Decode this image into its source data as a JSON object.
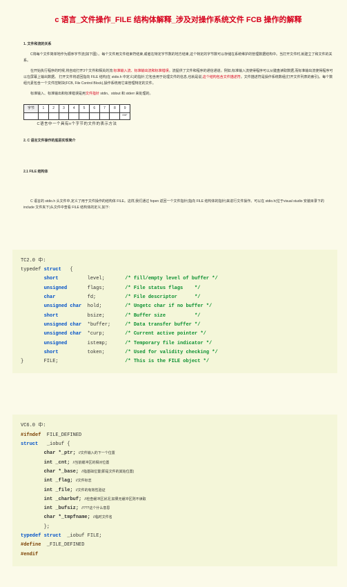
{
  "title": "c 语言_文件操作_FILE 结构体解释_涉及对操作系统文件 FCB 操作的解释",
  "s1": {
    "head": "1. 文件和流的关系",
    "p1a": "C将每个文件简单地作为顺序字节流(如下图) 。每个文件用文件结束符结束,或者在特定字节数的地方结束,这个特定的字节数可以存储在系统维护的管理数据结构中。当打开文件时,就建立了和文件的关系。",
    "p1b_1": "在开始执行程序的时候,将自动打开3个文件和相关的流:",
    "p1b_red": "标准输入流、标准输出流和标准错误",
    "p1b_2": "。流提供了文件和程序的通信通道。例如,标准输入流使得程序可以从键盘读取数据,而标准输出流使得程序可以在屏幕上输出数据。",
    "p1c_1": "打开文件将返回指向 FILE 结构(在 stdio.h 中定义)的指针,它包含用于处理文件的信息,也就是说,",
    "p1c_red": "这个结构包含文件描述符",
    "p1c_2": "。文件描述符是操作系统数组(打开文件列表的索引)。每个数组元素包含一个文件控制块(FCB, File Control Block),操作系统用它来管理特定的文件。",
    "p1d_1": "标准输入、标准输出和标准错误是用",
    "p1d_red": "文件指针",
    "p1d_2": " stdin、stdout 和 stderr 来处理的。",
    "fig_bytes_label": "字节",
    "fig_nums": [
      "1",
      "2",
      "3",
      "4",
      "5",
      "6",
      "7",
      "8",
      "9"
    ],
    "fig_row2": [
      "",
      "",
      "",
      "",
      "",
      "",
      "",
      "",
      "EOF"
    ],
    "fig_cap": "C语言中一个具有n个字节的文件的表示方法"
  },
  "s2": {
    "head": "2. C 语言文件操作的底层实现简介",
    "sub": "2.1  FILE 结构体",
    "p1": "C 语言的 stdio.h 头文件中,定义了用于文件操作的结构体 FILE。这样,我们通过 fopen 返回一个文件指针(指向 FILE 结构体的指针)来进行文件操作。可以在 stdio.h(位于visual studio 安装目录下的 include 文件夹下)头文件中查看 FILE 结构体的定义,如下:"
  },
  "tc": {
    "label": "TC2.0 中:",
    "lines": [
      {
        "pre": "typedef ",
        "kw": "struct",
        "post": "   {",
        "cm": ""
      },
      {
        "pre": "        ",
        "kw": "short",
        "post": "          level;",
        "cm": "/* fill/empty level of buffer */"
      },
      {
        "pre": "        ",
        "kw": "unsigned",
        "post": "       flags;",
        "cm": "/* File status flags    */"
      },
      {
        "pre": "        ",
        "kw": "char",
        "post": "           fd;",
        "cm": "/* File descriptor      */"
      },
      {
        "pre": "        ",
        "kw": "unsigned char",
        "post": "  hold;",
        "cm": "/* Ungetc char if no buffer */"
      },
      {
        "pre": "        ",
        "kw": "short",
        "post": "          bsize;",
        "cm": "/* Buffer size          */"
      },
      {
        "pre": "        ",
        "kw": "unsigned char",
        "post": "  *buffer;",
        "cm": "/* Data transfer buffer */"
      },
      {
        "pre": "        ",
        "kw": "unsigned char",
        "post": "  *curp;",
        "cm": "/* Current active pointer */"
      },
      {
        "pre": "        ",
        "kw": "unsigned",
        "post": "       istemp;",
        "cm": "/* Temporary file indicator */"
      },
      {
        "pre": "        ",
        "kw": "short",
        "post": "          token;",
        "cm": "/* Used for validity checking */"
      },
      {
        "pre": "}       FILE;",
        "kw": "",
        "post": "",
        "cm": "/* This is the FILE object */"
      }
    ]
  },
  "vc": {
    "label": "VC6.0 中:",
    "l1_a": "#ifndef",
    "l1_b": "  FILE_DEFINED",
    "l2_a": "struct",
    "l2_b": "   _iobuf {",
    "members": [
      {
        "t": "char *_ptr;",
        "c": "//文件输入的下一个位置"
      },
      {
        "t": "int _cnt;",
        "c": "//当前缓冲区的相对位置"
      },
      {
        "t": "char *_base;",
        "c": "//指基础位置(即是文件的其始位置)"
      },
      {
        "t": "int _flag;",
        "c": "//文件标志"
      },
      {
        "t": "int _file;",
        "c": "//文件的有效性验证"
      },
      {
        "t": "int _charbuf;",
        "c": "//检查缓冲区状况,如果无缓冲区则不读取"
      },
      {
        "t": "int _bufsiz;",
        "c": "//???这个什么意思"
      },
      {
        "t": "char *_tmpfname;",
        "c": "//临时文件名"
      }
    ],
    "close": "        };",
    "td_a": "typedef",
    "td_b": " struct",
    "td_c": "  _iobuf FILE;",
    "df_a": "#define",
    "df_b": "  _FILE_DEFINED",
    "end": "#endif"
  }
}
